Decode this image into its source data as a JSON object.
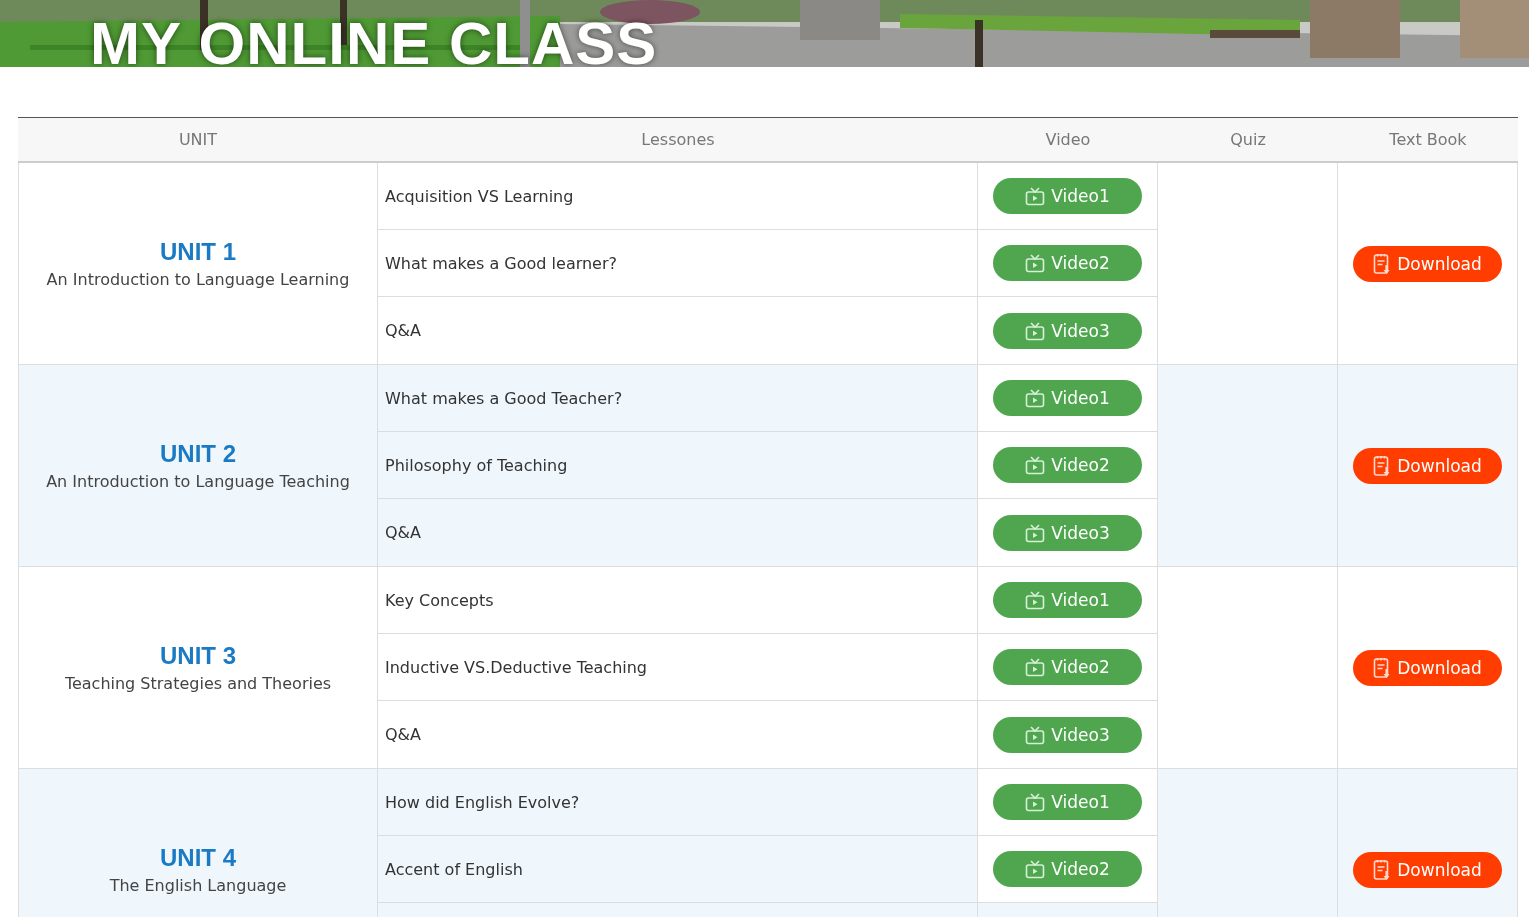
{
  "banner": {
    "title": "MY ONLINE CLASS"
  },
  "columns": [
    "UNIT",
    "Lessones",
    "Video",
    "Quiz",
    "Text Book"
  ],
  "units": [
    {
      "title": "UNIT 1",
      "subtitle": "An Introduction to Language Learning",
      "download": "Download",
      "lessons": [
        {
          "name": "Acquisition VS Learning",
          "video": "Video1"
        },
        {
          "name": "What makes a Good learner?",
          "video": "Video2"
        },
        {
          "name": "Q&A",
          "video": "Video3"
        }
      ]
    },
    {
      "title": "UNIT 2",
      "subtitle": "An Introduction to Language Teaching",
      "download": "Download",
      "lessons": [
        {
          "name": "What makes a Good Teacher?",
          "video": "Video1"
        },
        {
          "name": "Philosophy of Teaching",
          "video": "Video2"
        },
        {
          "name": "Q&A",
          "video": "Video3"
        }
      ]
    },
    {
      "title": "UNIT 3",
      "subtitle": "Teaching Strategies and Theories",
      "download": "Download",
      "lessons": [
        {
          "name": "Key Concepts",
          "video": "Video1"
        },
        {
          "name": "Inductive VS.Deductive Teaching",
          "video": "Video2"
        },
        {
          "name": "Q&A",
          "video": "Video3"
        }
      ]
    },
    {
      "title": "UNIT 4",
      "subtitle": "The English Language",
      "download": "Download",
      "lessons": [
        {
          "name": "How did English Evolve?",
          "video": "Video1"
        },
        {
          "name": "Accent of English",
          "video": "Video2"
        }
      ]
    }
  ]
}
